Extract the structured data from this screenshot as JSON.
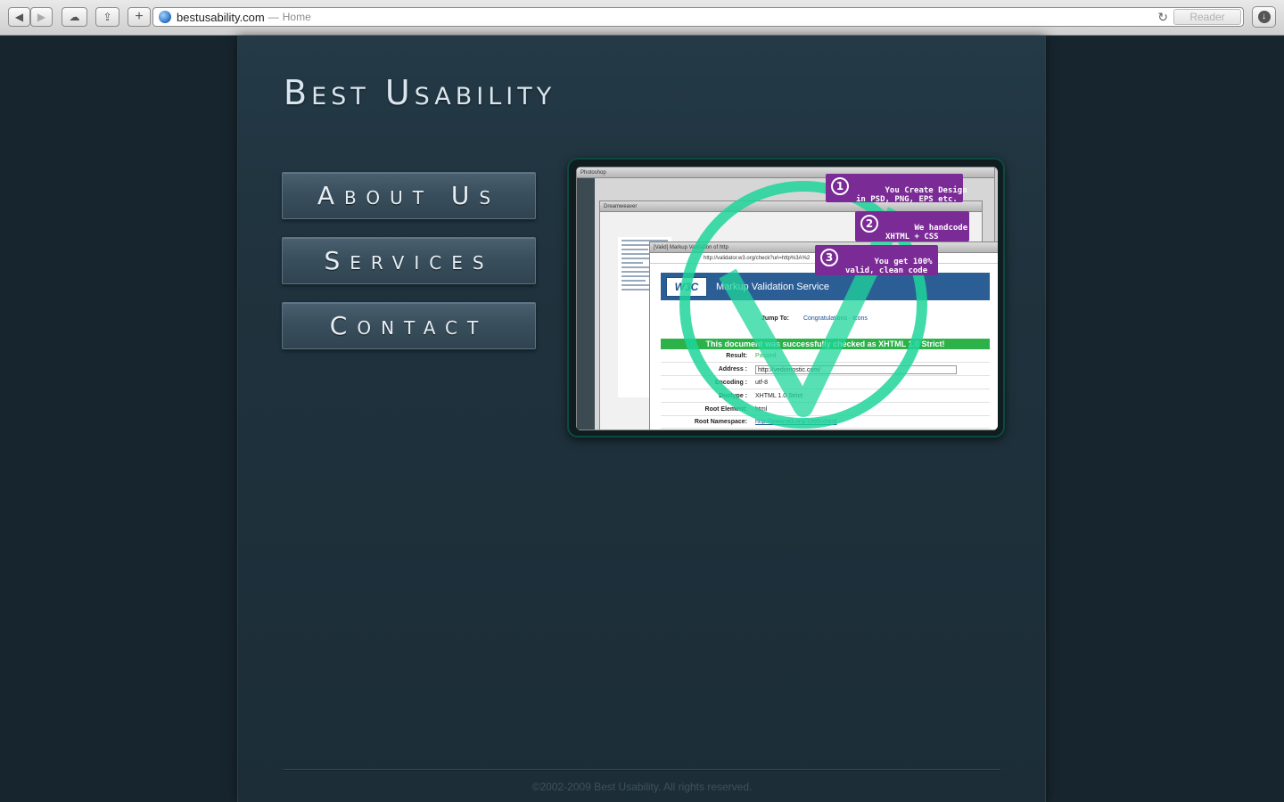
{
  "browser": {
    "url": "bestusability.com",
    "separator": "—",
    "page_title": "Home",
    "reader_label": "Reader",
    "new_tab_label": "+"
  },
  "site": {
    "logo": "Best Usability",
    "nav": [
      {
        "label": "About Us"
      },
      {
        "label": "Services"
      },
      {
        "label": "Contact"
      }
    ],
    "footer": "©2002-2009 Best Usability. All rights reserved."
  },
  "feature": {
    "callouts": [
      {
        "num": "1",
        "text": "You Create Design\nin PSD, PNG, EPS etc."
      },
      {
        "num": "2",
        "text": "We handcode\nXHTML + CSS"
      },
      {
        "num": "3",
        "text": "You get 100%\nvalid, clean code"
      }
    ],
    "validator": {
      "window_title": "[Valid] Markup Validation of http",
      "address": "http://validator.w3.org/check?uri=http%3A%2",
      "logo": "W3C",
      "service_title": "Markup Validation Service",
      "jump_label": "Jump To:",
      "jump_links": "Congratulations · Icons",
      "result_banner": "This document was successfully checked as XHTML 1.0 Strict!",
      "rows": [
        {
          "key": "Result:",
          "value": "Passed"
        },
        {
          "key": "Address :",
          "value": "http://vedomostic.com/"
        },
        {
          "key": "Encoding :",
          "value": "utf-8"
        },
        {
          "key": "Doctype :",
          "value": "XHTML 1.0 Strict"
        },
        {
          "key": "Root Element:",
          "value": "html"
        },
        {
          "key": "Root Namespace:",
          "value": "http://www.w3.org/1999/xhtml"
        }
      ]
    },
    "app_windows": [
      "Photoshop",
      "Dreamweaver"
    ],
    "colors": {
      "check": "#1fd59a",
      "callout": "#7b2b96",
      "banner": "#2db24a"
    }
  }
}
